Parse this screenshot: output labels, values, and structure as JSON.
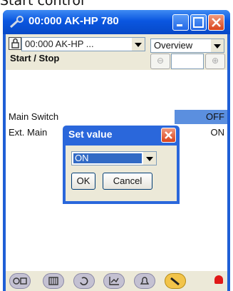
{
  "page": {
    "heading": "Start control"
  },
  "window": {
    "title": "00:000 AK-HP 780",
    "device_combo_value": "00:000 AK-HP ...",
    "view_combo_value": "Overview",
    "section_title": "Start / Stop"
  },
  "rows": [
    {
      "label": "Main Switch",
      "value": "OFF"
    },
    {
      "label": "Ext. Main",
      "value": "ON"
    }
  ],
  "dialog": {
    "title": "Set value",
    "select_value": "ON",
    "ok_label": "OK",
    "cancel_label": "Cancel"
  },
  "icons": {
    "title": "wrench-icon",
    "lock": "lock-icon",
    "minimize": "minimize-icon",
    "maximize": "maximize-icon",
    "close": "close-icon",
    "tabs": [
      "network-icon",
      "keyboard-icon",
      "refresh-icon",
      "graph-icon",
      "bell-icon",
      "wrench-icon"
    ],
    "alarm": "alarm-icon"
  },
  "colors": {
    "accent": "#0a56e0",
    "highlight": "#5b8fdf"
  }
}
